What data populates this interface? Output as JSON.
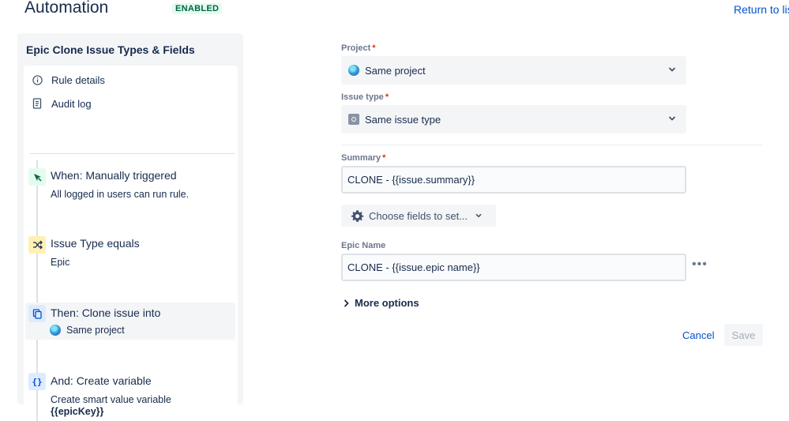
{
  "header": {
    "title": "Automation",
    "status_badge": "ENABLED",
    "return_link": "Return to list"
  },
  "sidebar": {
    "rule_name": "Epic Clone Issue Types & Fields",
    "nav": [
      {
        "label": "Rule details",
        "icon": "info-icon"
      },
      {
        "label": "Audit log",
        "icon": "document-icon"
      }
    ],
    "steps": [
      {
        "title": "When: Manually triggered",
        "desc": "All logged in users can run rule.",
        "icon": "cursor-click-icon",
        "color": "#e3fcef"
      },
      {
        "title": "Issue Type equals",
        "desc": "Epic",
        "icon": "shuffle-icon",
        "color": "#fffae6"
      },
      {
        "title": "Then: Clone issue into",
        "desc": "Same project",
        "icon": "copy-icon",
        "color": "#deebff"
      },
      {
        "title": "And: Create variable",
        "desc": "Create smart value variable",
        "desc_strong": "{{epicKey}}",
        "icon": "braces-icon",
        "color": "#deebff"
      }
    ]
  },
  "form": {
    "project": {
      "label": "Project",
      "value": "Same project"
    },
    "issue_type": {
      "label": "Issue type",
      "value": "Same issue type"
    },
    "summary": {
      "label": "Summary",
      "value": "CLONE - {{issue.summary}}"
    },
    "choose_fields_label": "Choose fields to set...",
    "epic_name": {
      "label": "Epic Name",
      "value": "CLONE - {{issue.epic name}}"
    },
    "more_options_label": "More options",
    "cancel_label": "Cancel",
    "save_label": "Save"
  },
  "colors": {
    "accent": "#0052cc",
    "required": "#de350b",
    "enabled_badge_bg": "#e3fcef",
    "enabled_badge_text": "#006644"
  }
}
